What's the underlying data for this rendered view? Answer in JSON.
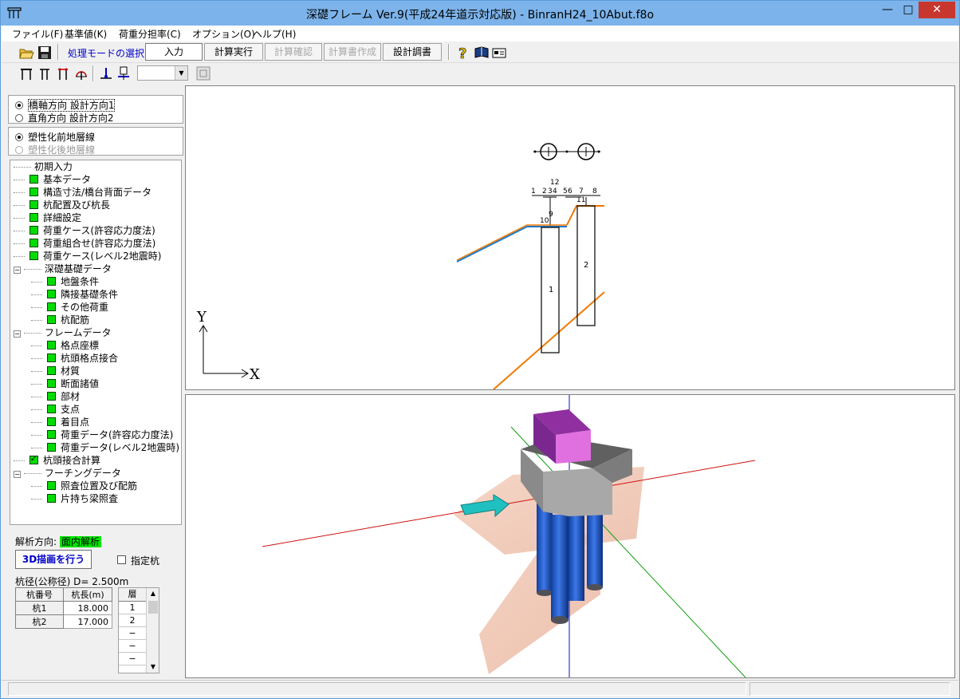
{
  "window": {
    "title": "深礎フレーム Ver.9(平成24年道示対応版) - BinranH24_10Abut.f8o",
    "minimize": "—",
    "maximize": "□",
    "close": "✕"
  },
  "menu": [
    {
      "label": "ファイル(F)"
    },
    {
      "label": "基準値(K)"
    },
    {
      "label": "荷重分担率(C)"
    },
    {
      "label": "オプション(O)"
    },
    {
      "label": "ヘルプ(H)"
    }
  ],
  "toolbar": {
    "mode_label": "処理モードの選択",
    "modes": [
      "入力",
      "計算実行",
      "計算確認",
      "計算書作成",
      "設計調書"
    ],
    "combo_value": ""
  },
  "direction": {
    "options": [
      "橋軸方向 設計方向1",
      "直角方向 設計方向2"
    ],
    "selected": 0
  },
  "stratum": {
    "options": [
      "塑性化前地層線",
      "塑性化後地層線"
    ],
    "selected": 0
  },
  "tree": {
    "root_items": [
      {
        "label": "初期入力",
        "status": "none"
      },
      {
        "label": "基本データ",
        "status": "done"
      },
      {
        "label": "構造寸法/橋台背面データ",
        "status": "done"
      },
      {
        "label": "杭配置及び杭長",
        "status": "done"
      },
      {
        "label": "詳細設定",
        "status": "done"
      },
      {
        "label": "荷重ケース(許容応力度法)",
        "status": "done"
      },
      {
        "label": "荷重組合せ(許容応力度法)",
        "status": "done"
      },
      {
        "label": "荷重ケース(レベル2地震時)",
        "status": "done"
      }
    ],
    "group1": {
      "label": "深礎基礎データ",
      "children": [
        "地盤条件",
        "隣接基礎条件",
        "その他荷重",
        "杭配筋"
      ]
    },
    "group2": {
      "label": "フレームデータ",
      "children": [
        "格点座標",
        "杭頭格点接合",
        "材質",
        "断面諸値",
        "部材",
        "支点",
        "着目点",
        "荷重データ(許容応力度法)",
        "荷重データ(レベル2地震時)"
      ]
    },
    "pile_head_calc": "杭頭接合計算",
    "group3": {
      "label": "フーチングデータ",
      "children": [
        "照査位置及び配筋",
        "片持ち梁照査"
      ]
    }
  },
  "analysis": {
    "label": "解析方向:",
    "value": "面内解析"
  },
  "draw3d_button": "3D描画を行う",
  "specified_pile": "指定杭",
  "pile_diameter": "杭径(公称径) D= 2.500m",
  "pile_table": {
    "headers": [
      "杭番号",
      "杭長(m)"
    ],
    "rows": [
      [
        "杭1",
        "18.000"
      ],
      [
        "杭2",
        "17.000"
      ]
    ]
  },
  "layer_table": {
    "header": "層",
    "rows": [
      "1",
      "2",
      "−",
      "−",
      "−"
    ]
  },
  "view2d": {
    "y_axis": "Y",
    "x_axis": "X",
    "node_labels": [
      "12",
      "1",
      "2",
      "3",
      "4",
      "5",
      "6",
      "7",
      "8",
      "9",
      "10",
      "11"
    ],
    "pile_labels": [
      "1",
      "2"
    ]
  },
  "colors": {
    "check_green": "#00dc00",
    "orange_line": "#f07800",
    "blue_line": "#1e78c8",
    "pile_blue": "#1e5ad2",
    "pier_magenta": "#c040c8",
    "arrow_cyan": "#18b4b4"
  }
}
